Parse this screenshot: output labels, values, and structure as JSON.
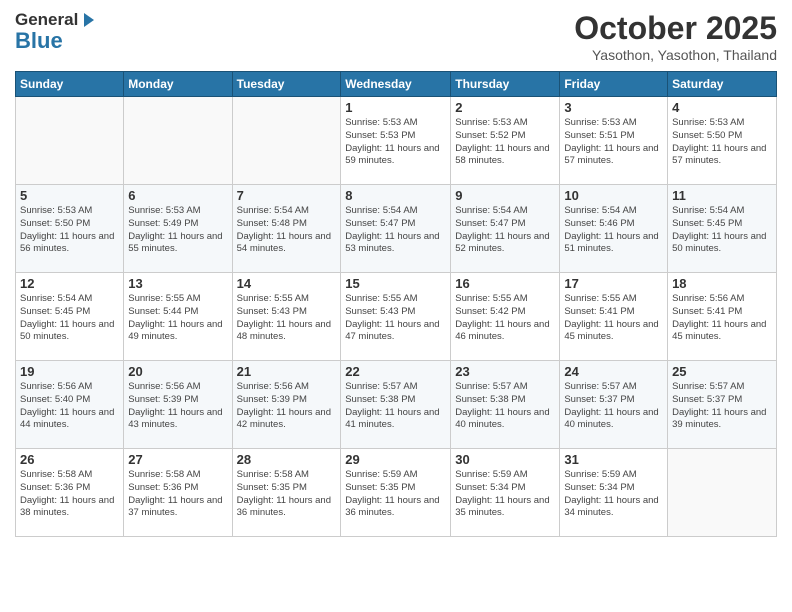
{
  "logo": {
    "general": "General",
    "blue": "Blue",
    "arrow": "▶"
  },
  "title": "October 2025",
  "location": "Yasothon, Yasothon, Thailand",
  "weekdays": [
    "Sunday",
    "Monday",
    "Tuesday",
    "Wednesday",
    "Thursday",
    "Friday",
    "Saturday"
  ],
  "weeks": [
    [
      {
        "day": "",
        "info": ""
      },
      {
        "day": "",
        "info": ""
      },
      {
        "day": "",
        "info": ""
      },
      {
        "day": "1",
        "info": "Sunrise: 5:53 AM\nSunset: 5:53 PM\nDaylight: 11 hours\nand 59 minutes."
      },
      {
        "day": "2",
        "info": "Sunrise: 5:53 AM\nSunset: 5:52 PM\nDaylight: 11 hours\nand 58 minutes."
      },
      {
        "day": "3",
        "info": "Sunrise: 5:53 AM\nSunset: 5:51 PM\nDaylight: 11 hours\nand 57 minutes."
      },
      {
        "day": "4",
        "info": "Sunrise: 5:53 AM\nSunset: 5:50 PM\nDaylight: 11 hours\nand 57 minutes."
      }
    ],
    [
      {
        "day": "5",
        "info": "Sunrise: 5:53 AM\nSunset: 5:50 PM\nDaylight: 11 hours\nand 56 minutes."
      },
      {
        "day": "6",
        "info": "Sunrise: 5:53 AM\nSunset: 5:49 PM\nDaylight: 11 hours\nand 55 minutes."
      },
      {
        "day": "7",
        "info": "Sunrise: 5:54 AM\nSunset: 5:48 PM\nDaylight: 11 hours\nand 54 minutes."
      },
      {
        "day": "8",
        "info": "Sunrise: 5:54 AM\nSunset: 5:47 PM\nDaylight: 11 hours\nand 53 minutes."
      },
      {
        "day": "9",
        "info": "Sunrise: 5:54 AM\nSunset: 5:47 PM\nDaylight: 11 hours\nand 52 minutes."
      },
      {
        "day": "10",
        "info": "Sunrise: 5:54 AM\nSunset: 5:46 PM\nDaylight: 11 hours\nand 51 minutes."
      },
      {
        "day": "11",
        "info": "Sunrise: 5:54 AM\nSunset: 5:45 PM\nDaylight: 11 hours\nand 50 minutes."
      }
    ],
    [
      {
        "day": "12",
        "info": "Sunrise: 5:54 AM\nSunset: 5:45 PM\nDaylight: 11 hours\nand 50 minutes."
      },
      {
        "day": "13",
        "info": "Sunrise: 5:55 AM\nSunset: 5:44 PM\nDaylight: 11 hours\nand 49 minutes."
      },
      {
        "day": "14",
        "info": "Sunrise: 5:55 AM\nSunset: 5:43 PM\nDaylight: 11 hours\nand 48 minutes."
      },
      {
        "day": "15",
        "info": "Sunrise: 5:55 AM\nSunset: 5:43 PM\nDaylight: 11 hours\nand 47 minutes."
      },
      {
        "day": "16",
        "info": "Sunrise: 5:55 AM\nSunset: 5:42 PM\nDaylight: 11 hours\nand 46 minutes."
      },
      {
        "day": "17",
        "info": "Sunrise: 5:55 AM\nSunset: 5:41 PM\nDaylight: 11 hours\nand 45 minutes."
      },
      {
        "day": "18",
        "info": "Sunrise: 5:56 AM\nSunset: 5:41 PM\nDaylight: 11 hours\nand 45 minutes."
      }
    ],
    [
      {
        "day": "19",
        "info": "Sunrise: 5:56 AM\nSunset: 5:40 PM\nDaylight: 11 hours\nand 44 minutes."
      },
      {
        "day": "20",
        "info": "Sunrise: 5:56 AM\nSunset: 5:39 PM\nDaylight: 11 hours\nand 43 minutes."
      },
      {
        "day": "21",
        "info": "Sunrise: 5:56 AM\nSunset: 5:39 PM\nDaylight: 11 hours\nand 42 minutes."
      },
      {
        "day": "22",
        "info": "Sunrise: 5:57 AM\nSunset: 5:38 PM\nDaylight: 11 hours\nand 41 minutes."
      },
      {
        "day": "23",
        "info": "Sunrise: 5:57 AM\nSunset: 5:38 PM\nDaylight: 11 hours\nand 40 minutes."
      },
      {
        "day": "24",
        "info": "Sunrise: 5:57 AM\nSunset: 5:37 PM\nDaylight: 11 hours\nand 40 minutes."
      },
      {
        "day": "25",
        "info": "Sunrise: 5:57 AM\nSunset: 5:37 PM\nDaylight: 11 hours\nand 39 minutes."
      }
    ],
    [
      {
        "day": "26",
        "info": "Sunrise: 5:58 AM\nSunset: 5:36 PM\nDaylight: 11 hours\nand 38 minutes."
      },
      {
        "day": "27",
        "info": "Sunrise: 5:58 AM\nSunset: 5:36 PM\nDaylight: 11 hours\nand 37 minutes."
      },
      {
        "day": "28",
        "info": "Sunrise: 5:58 AM\nSunset: 5:35 PM\nDaylight: 11 hours\nand 36 minutes."
      },
      {
        "day": "29",
        "info": "Sunrise: 5:59 AM\nSunset: 5:35 PM\nDaylight: 11 hours\nand 36 minutes."
      },
      {
        "day": "30",
        "info": "Sunrise: 5:59 AM\nSunset: 5:34 PM\nDaylight: 11 hours\nand 35 minutes."
      },
      {
        "day": "31",
        "info": "Sunrise: 5:59 AM\nSunset: 5:34 PM\nDaylight: 11 hours\nand 34 minutes."
      },
      {
        "day": "",
        "info": ""
      }
    ]
  ]
}
